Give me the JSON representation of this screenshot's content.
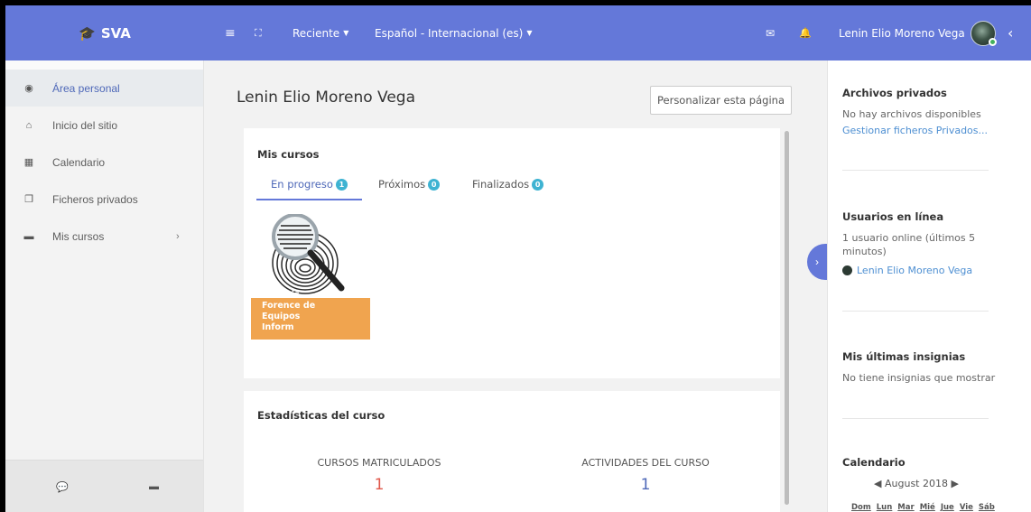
{
  "topbar": {
    "brand": "SVA",
    "recent_label": "Reciente",
    "language_label": "Español - Internacional (es)",
    "user_name": "Lenin Elio Moreno Vega"
  },
  "sidebar": {
    "items": [
      {
        "label": "Área personal",
        "icon": "dashboard-icon"
      },
      {
        "label": "Inicio del sitio",
        "icon": "home-icon"
      },
      {
        "label": "Calendario",
        "icon": "calendar-icon"
      },
      {
        "label": "Ficheros privados",
        "icon": "files-icon"
      },
      {
        "label": "Mis cursos",
        "icon": "archive-icon"
      }
    ]
  },
  "main": {
    "title": "Lenin Elio Moreno Vega",
    "customize_button": "Personalizar esta página",
    "my_courses": {
      "title": "Mis cursos",
      "tabs": [
        {
          "label": "En progreso",
          "count": "1"
        },
        {
          "label": "Próximos",
          "count": "0"
        },
        {
          "label": "Finalizados",
          "count": "0"
        }
      ],
      "course_name": "Analisis Forence de Equipos Inform"
    },
    "stats": {
      "title": "Estadísticas del curso",
      "enrolled_label": "CURSOS MATRICULADOS",
      "enrolled_value": "1",
      "activities_label": "ACTIVIDADES DEL CURSO",
      "activities_value": "1"
    }
  },
  "right": {
    "private_files": {
      "title": "Archivos privados",
      "empty_text": "No hay archivos disponibles",
      "manage_link": "Gestionar ficheros Privados..."
    },
    "online_users": {
      "title": "Usuarios en línea",
      "summary": "1 usuario online (últimos 5 minutos)",
      "user": "Lenin Elio Moreno Vega"
    },
    "badges": {
      "title": "Mis últimas insignias",
      "empty_text": "No tiene insignias que mostrar"
    },
    "calendar": {
      "title": "Calendario",
      "month": "August 2018",
      "prev_arrow": "◀",
      "next_arrow": "▶",
      "days": [
        "Dom",
        "Lun",
        "Mar",
        "Mié",
        "Jue",
        "Vie",
        "Sáb"
      ]
    }
  },
  "colors": {
    "brand": "#6478d9",
    "badge": "#3eb3d2",
    "course_band": "#f0a44f",
    "enrolled_value": "#e0574a",
    "activities_value": "#4e68b8",
    "link": "#4e8fd2"
  }
}
